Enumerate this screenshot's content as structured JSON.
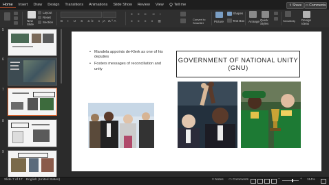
{
  "menu": {
    "tabs": [
      "Home",
      "Insert",
      "Draw",
      "Design",
      "Transitions",
      "Animations",
      "Slide Show",
      "Review",
      "View"
    ],
    "tell_me": "Tell me",
    "share": "Share",
    "comments": "Comments"
  },
  "ribbon": {
    "new_slide": "New\nSlide",
    "layout": "Layout",
    "reset": "Reset",
    "section": "Section",
    "convert_smartart": "Convert to\nSmartArt",
    "picture": "Picture",
    "shapes": "Shapes",
    "text_box": "Text Box",
    "arrange": "Arrange",
    "quick_styles": "Quick\nStyles",
    "sensitivity": "Sensitivity",
    "design_ideas": "Design\nIdeas"
  },
  "thumbnails": [
    {
      "num": "5"
    },
    {
      "num": "6"
    },
    {
      "num": "7"
    },
    {
      "num": "8"
    },
    {
      "num": "9"
    }
  ],
  "slide": {
    "bullets": [
      "Mandela appoints de-Klerk as one of his deputies",
      "Fosters messages of reconciliation and unity"
    ],
    "title": "GOVERNMENT OF NATIONAL UNITY (GNU)"
  },
  "status": {
    "slide_of": "Slide 7 of 17",
    "language": "English (United States)",
    "notes": "Notes",
    "comments": "Comments",
    "zoom": "114%"
  },
  "colors": {
    "accent": "#e05a2b",
    "chrome_dark": "#1e1e1e",
    "chrome": "#2b2b2b"
  }
}
